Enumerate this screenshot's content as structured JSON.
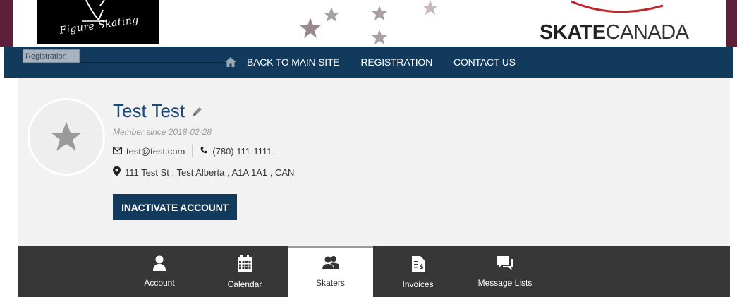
{
  "banner": {
    "logo_text": "Figure Skating",
    "brand_bold": "SKATE",
    "brand_light": "CANADA"
  },
  "navbar": {
    "registration_tag": "Registration",
    "links": [
      "BACK TO MAIN SITE",
      "REGISTRATION",
      "CONTACT US"
    ]
  },
  "profile": {
    "name": "Test Test",
    "member_since": "Member since 2018-02-28",
    "email": "test@test.com",
    "phone": "(780) 111-1111",
    "address": "111 Test St , Test Alberta , A1A 1A1 , CAN",
    "inactivate_label": "INACTIVATE ACCOUNT"
  },
  "tabs": [
    {
      "label": "Account",
      "icon": "user-icon"
    },
    {
      "label": "Calendar",
      "icon": "calendar-icon"
    },
    {
      "label": "Skaters",
      "icon": "users-icon",
      "active": true
    },
    {
      "label": "Invoices",
      "icon": "invoice-icon"
    },
    {
      "label": "Message Lists",
      "icon": "chat-icon"
    }
  ],
  "colors": {
    "primary": "#123a5c",
    "name": "#1c4a7a",
    "tabs_bg": "#373737",
    "profile_bg": "#f2f2f2"
  }
}
